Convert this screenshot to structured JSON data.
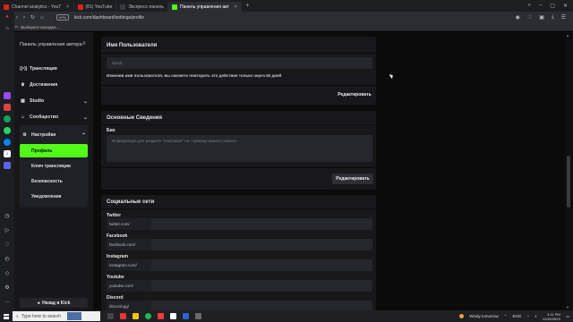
{
  "browser": {
    "tabs": [
      {
        "label": "Channel analytics - YouT",
        "favicon_color": "#e62117",
        "active": false
      },
      {
        "label": "(81) YouTube",
        "favicon_color": "#e62117",
        "active": false
      },
      {
        "label": "Экспресс-панель",
        "favicon_color": "#3a3b41",
        "active": false
      },
      {
        "label": "Панель управления авт",
        "favicon_color": "#53fc18",
        "active": true
      }
    ],
    "new_tab": "+",
    "url": "kick.com/dashboard/settings/profile",
    "vpn_label": "VPN",
    "bookmarks_label": "Выберите вкладки..."
  },
  "kick_sidebar": {
    "title": "Панель управления автора",
    "items": [
      {
        "label": "Трансляция",
        "icon": "broadcast-icon"
      },
      {
        "label": "Достижения",
        "icon": "trophy-icon"
      },
      {
        "label": "Studio",
        "icon": "studio-icon"
      },
      {
        "label": "Сообщество",
        "icon": "community-icon"
      }
    ],
    "settings": {
      "label": "Настройки",
      "sub_items": [
        {
          "label": "Профиль",
          "active": true
        },
        {
          "label": "Ключ трансляции",
          "active": false
        },
        {
          "label": "Безопасность",
          "active": false
        },
        {
          "label": "Уведомления",
          "active": false
        }
      ]
    },
    "back_button": "Назад в Kick"
  },
  "username_card": {
    "title": "Имя Пользователя",
    "value": "Djsob",
    "hint": "Изменив имя пользователя, вы сможете повторить это действие только через 60 дней",
    "edit_button": "Редактировать"
  },
  "basic_info_card": {
    "title": "Основные Сведения",
    "bio_label": "Био",
    "bio_placeholder": "Информация для раздела \"Описание\" на странице вашего канала",
    "edit_button": "Редактировать"
  },
  "social_card": {
    "title": "Социальные сети",
    "networks": [
      {
        "label": "Twitter",
        "prefix": "twitter.com/"
      },
      {
        "label": "Facebook",
        "prefix": "facebook.com/"
      },
      {
        "label": "Instagram",
        "prefix": "instagram.com/"
      },
      {
        "label": "Youtube",
        "prefix": "youtube.com/"
      },
      {
        "label": "Discord",
        "prefix": "discord.gg/"
      }
    ]
  },
  "taskbar": {
    "search_placeholder": "Type here to search",
    "weather": "Windy tomorrow",
    "lang": "ENG",
    "time": "3:11 PM",
    "date": "12/30/2023"
  },
  "colors": {
    "accent": "#53fc18",
    "panel": "#18181b",
    "background": "#0b0b0c"
  }
}
